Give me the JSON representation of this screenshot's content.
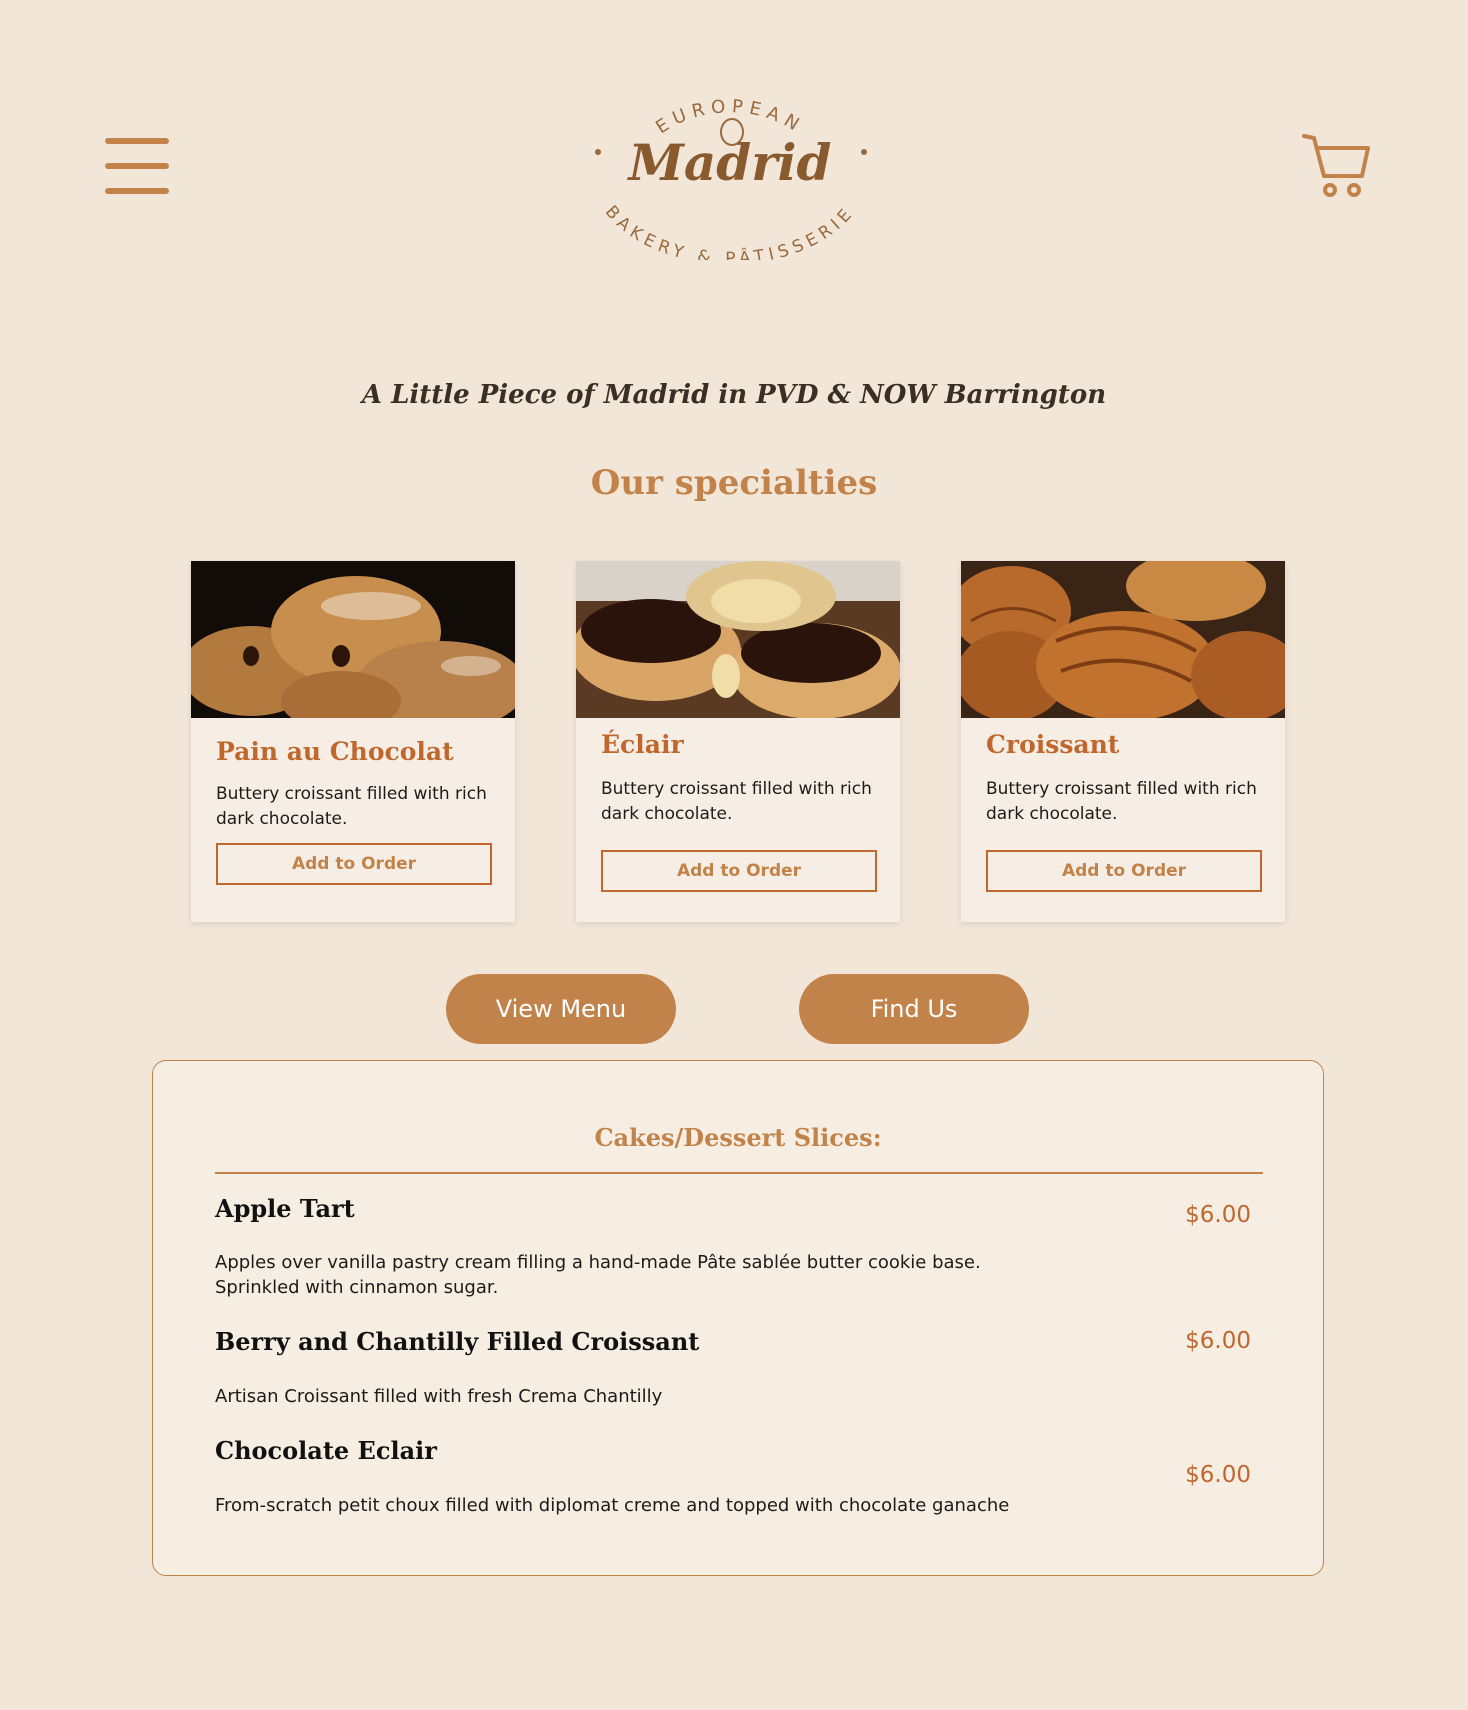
{
  "header": {
    "menu_icon": "hamburger-icon",
    "cart_icon": "shopping-cart-icon",
    "logo": {
      "top_text": "EUROPEAN",
      "name": "Madrid",
      "bottom_text": "BAKERY & PÂTISSERIE"
    }
  },
  "tagline": "A Little Piece of Madrid in PVD & NOW Barrington",
  "specialties": {
    "title": "Our specialties",
    "cards": [
      {
        "name": "Pain au Chocolat",
        "description": "Buttery croissant filled with rich dark chocolate.",
        "button": "Add to Order"
      },
      {
        "name": "Éclair",
        "description": "Buttery croissant filled with rich dark chocolate.",
        "button": "Add to Order"
      },
      {
        "name": "Croissant",
        "description": "Buttery croissant filled with rich dark chocolate.",
        "button": "Add to Order"
      }
    ]
  },
  "actions": {
    "view_menu": "View Menu",
    "find_us": "Find Us"
  },
  "menu": {
    "heading": "Cakes/Dessert Slices:",
    "items": [
      {
        "name": "Apple Tart",
        "price": "$6.00",
        "description": "Apples over vanilla pastry cream filling a hand-made Pâte sablée butter cookie base. Sprinkled with cinnamon sugar."
      },
      {
        "name": "Berry and Chantilly Filled Croissant",
        "price": "$6.00",
        "description": "Artisan Croissant filled with fresh Crema Chantilly"
      },
      {
        "name": "Chocolate Eclair",
        "price": "$6.00",
        "description": "From-scratch petit choux filled with diplomat creme and topped with chocolate ganache"
      }
    ]
  },
  "colors": {
    "background": "#f2e6d9",
    "accent": "#c2834a",
    "title_accent": "#c0672e",
    "card_bg": "#f6eee4"
  }
}
